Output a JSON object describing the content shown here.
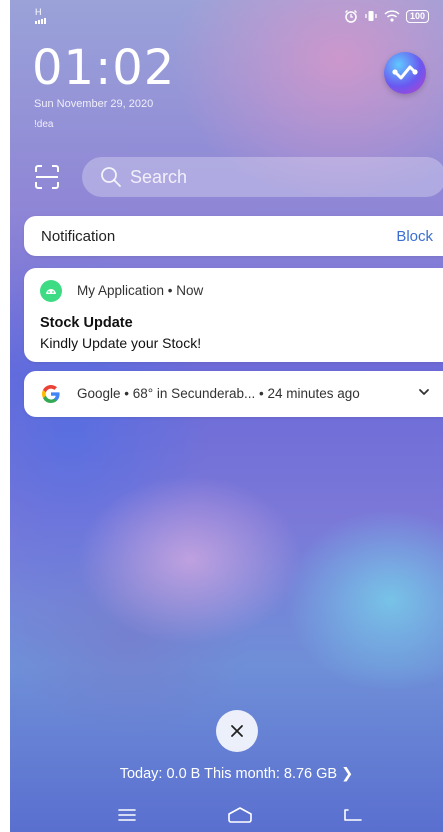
{
  "status_bar": {
    "network_label": "H",
    "battery": "100",
    "icons": [
      "alarm-icon",
      "vibrate-icon",
      "wifi-icon",
      "battery-icon"
    ]
  },
  "lockscreen": {
    "time": "01:02",
    "date": "Sun November 29, 2020",
    "carrier": "!dea"
  },
  "search": {
    "placeholder": "Search"
  },
  "notification_header": {
    "title": "Notification",
    "action": "Block"
  },
  "notifications": [
    {
      "app_line": "My Application • Now",
      "title": "Stock Update",
      "body": "Kindly Update your Stock!",
      "icon": "android-icon",
      "icon_color": "#3DDC84"
    },
    {
      "app_line": "Google • 68° in Secunderab... • 24 minutes ago",
      "icon": "google-g-icon"
    }
  ],
  "data_usage": {
    "text": "Today: 0.0 B This month: 8.76 GB",
    "arrow": "❯"
  },
  "colors": {
    "accent_blue": "#3A6FD1",
    "card_bg": "#FFFFFF"
  }
}
